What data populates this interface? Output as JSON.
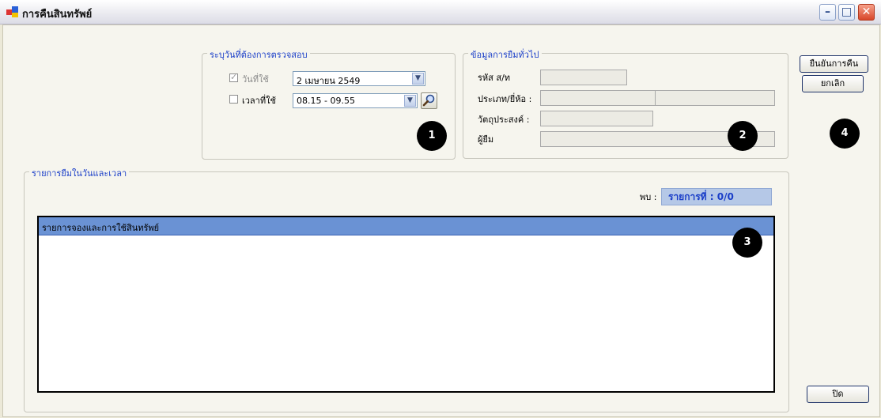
{
  "window": {
    "title": "การคืนสินทรัพย์",
    "minimize_glyph": "–",
    "maximize_glyph": "□",
    "close_glyph": "✕"
  },
  "check_period": {
    "legend": "ระบุวันที่ต้องการตรวจสอบ",
    "date_label": "วันที่ใช้",
    "date_checked": true,
    "date_value": "2  เมษายน     2549",
    "time_label": "เวลาที่ใช้",
    "time_checked": false,
    "time_value": "08.15 - 09.55"
  },
  "general_info": {
    "legend": "ข้อมูลการยืมทั่วไป",
    "code_label": "รหัส ส/ท",
    "code_value": "",
    "type_brand_label": "ประเภท/ยี่ห้อ :",
    "type_value": "",
    "brand_value": "",
    "purpose_label": "วัตถุประสงค์ :",
    "purpose_value": "",
    "borrower_label": "ผู้ยืม",
    "borrower_value": ""
  },
  "actions": {
    "confirm_return": "ยืนยันการคืน",
    "cancel": "ยกเลิก",
    "close": "ปิด"
  },
  "borrow_list": {
    "legend": "รายการยืมในวันและเวลา",
    "found_label": "พบ :",
    "found_value": "รายการที่ : 0/0",
    "header": "รายการจองและการใช้สินทรัพย์",
    "rows": []
  },
  "markers": [
    "1",
    "2",
    "3",
    "4"
  ]
}
